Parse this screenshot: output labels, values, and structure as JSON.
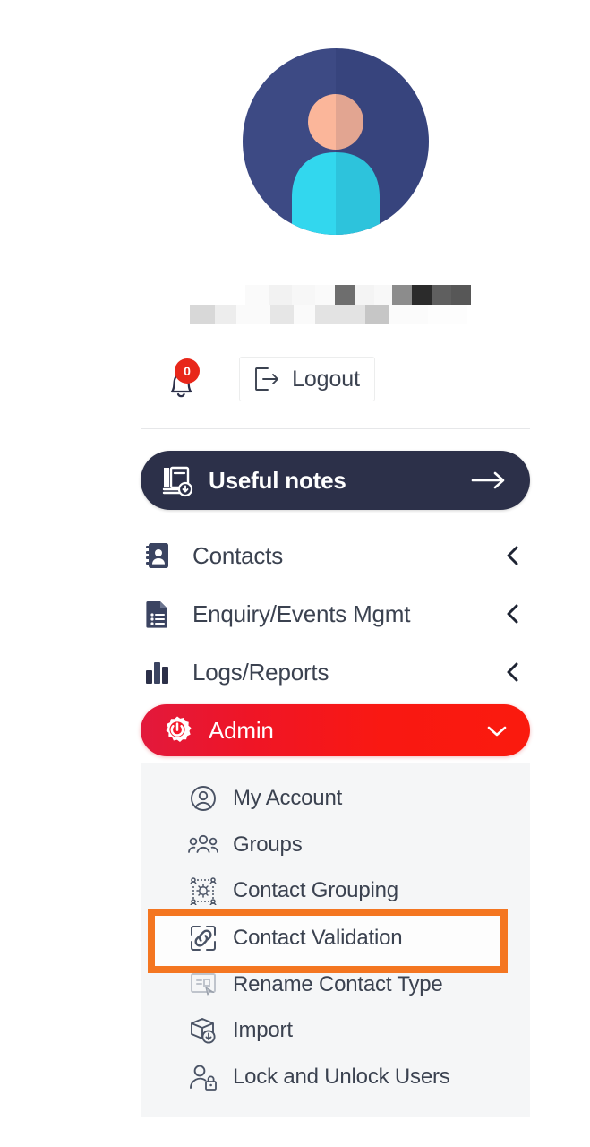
{
  "app": {
    "main_title_fragment": "S",
    "accent_red": "#f91812",
    "accent_dark": "#2c3049",
    "highlight_orange": "#f47621",
    "panel_bg": "#f5f6f7",
    "text_color": "#3b4250"
  },
  "profile": {
    "avatar_icon": "user-avatar-icon",
    "username_redacted": "",
    "avatar_colors": {
      "circle": "#3d4a84",
      "head": "#fbb69a",
      "body": "#32d7ee"
    }
  },
  "actions": {
    "notifications": {
      "icon": "bell-icon",
      "count": "0",
      "badge_color": "#e8271a"
    },
    "logout": {
      "icon": "logout-icon",
      "label": "Logout"
    }
  },
  "useful_notes": {
    "icon": "book-add-icon",
    "label": "Useful notes",
    "arrow_icon": "arrow-right-icon"
  },
  "nav": {
    "items": [
      {
        "label": "Contacts",
        "icon": "address-book-icon",
        "chevron": "chevron-left-icon",
        "expanded": false
      },
      {
        "label": "Enquiry/Events Mgmt",
        "icon": "document-list-icon",
        "chevron": "chevron-left-icon",
        "expanded": false
      },
      {
        "label": "Logs/Reports",
        "icon": "bar-chart-icon",
        "chevron": "chevron-left-icon",
        "expanded": false
      },
      {
        "label": "Admin",
        "icon": "gear-power-icon",
        "chevron": "chevron-down-icon",
        "expanded": true
      }
    ]
  },
  "submenu": {
    "parent": "Admin",
    "items": [
      {
        "label": "My Account",
        "icon": "user-circle-icon",
        "selected": false,
        "dimmed": false
      },
      {
        "label": "Groups",
        "icon": "people-group-icon",
        "selected": false,
        "dimmed": false
      },
      {
        "label": "Contact Grouping",
        "icon": "contact-grouping-icon",
        "selected": false,
        "dimmed": false
      },
      {
        "label": "Contact Validation",
        "icon": "link-box-icon",
        "selected": true,
        "dimmed": false
      },
      {
        "label": "Rename Contact Type",
        "icon": "rename-tag-icon",
        "selected": false,
        "dimmed": true
      },
      {
        "label": "Import",
        "icon": "box-download-icon",
        "selected": false,
        "dimmed": false
      },
      {
        "label": "Lock and Unlock Users",
        "icon": "user-lock-icon",
        "selected": false,
        "dimmed": false
      }
    ]
  }
}
